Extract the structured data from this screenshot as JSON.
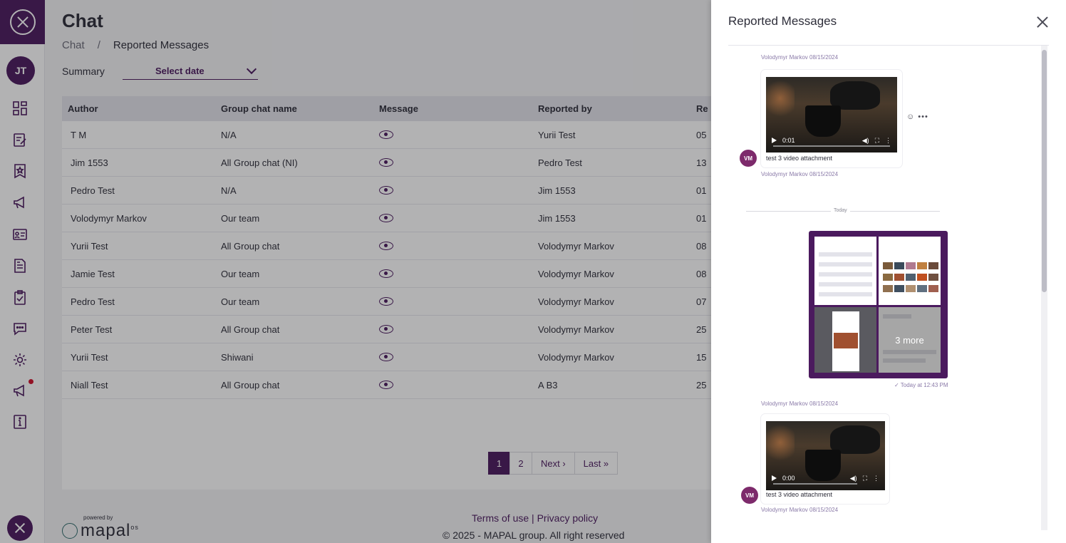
{
  "sidebar": {
    "avatar_initials": "JT",
    "icons": [
      "dashboard-icon",
      "edit-icon",
      "bookmark-star-icon",
      "megaphone-icon",
      "id-card-icon",
      "document-icon",
      "clipboard-icon",
      "chat-icon",
      "gear-icon",
      "announcement-icon",
      "info-icon"
    ]
  },
  "page": {
    "title": "Chat",
    "breadcrumb": [
      "Chat",
      "/",
      "Reported Messages"
    ],
    "summary_label": "Summary",
    "date_placeholder": "Select date"
  },
  "table": {
    "columns": [
      "Author",
      "Group chat name",
      "Message",
      "Reported by",
      "Re"
    ],
    "rows": [
      {
        "author": "T M",
        "group": "N/A",
        "reported_by": "Yurii Test",
        "r": "05"
      },
      {
        "author": "Jim 1553",
        "group": "All Group chat (NI)",
        "reported_by": "Pedro Test",
        "r": "13"
      },
      {
        "author": "Pedro Test",
        "group": "N/A",
        "reported_by": "Jim 1553",
        "r": "01"
      },
      {
        "author": "Volodymyr Markov",
        "group": "Our team",
        "reported_by": "Jim 1553",
        "r": "01"
      },
      {
        "author": "Yurii Test",
        "group": "All Group chat",
        "reported_by": "Volodymyr Markov",
        "r": "08"
      },
      {
        "author": "Jamie Test",
        "group": "Our team",
        "reported_by": "Volodymyr Markov",
        "r": "08"
      },
      {
        "author": "Pedro Test",
        "group": "Our team",
        "reported_by": "Volodymyr Markov",
        "r": "07"
      },
      {
        "author": "Peter Test",
        "group": "All Group chat",
        "reported_by": "Volodymyr Markov",
        "r": "25"
      },
      {
        "author": "Yurii Test",
        "group": "Shiwani",
        "reported_by": "Volodymyr Markov",
        "r": "15"
      },
      {
        "author": "Niall Test",
        "group": "All Group chat",
        "reported_by": "A B3",
        "r": "25"
      }
    ]
  },
  "pagination": {
    "pages": [
      "1",
      "2"
    ],
    "next": "Next ›",
    "last": "Last »"
  },
  "footer": {
    "powered_by": "powered by",
    "brand": "mapal",
    "brand_suffix": "os",
    "terms": "Terms of use",
    "separator": " | ",
    "privacy": "Privacy policy",
    "copyright": "© 2025 - MAPAL group. All right reserved"
  },
  "panel": {
    "title": "Reported Messages",
    "messages": [
      {
        "top_meta": "Volodymyr Markov  08/15/2024",
        "time": "0:01",
        "caption": "test 3 video attachment",
        "author_meta": "Volodymyr Markov  08/15/2024",
        "initials": "VM"
      },
      {
        "time": "0:00",
        "caption": "test 3 video attachment",
        "author_meta": "Volodymyr Markov  08/15/2024",
        "initials": "VM",
        "top_meta": "Volodymyr Markov  08/15/2024"
      }
    ],
    "day_label": "Today",
    "gallery_more": "3 more",
    "gallery_time": "✓ Today at 12:43 PM",
    "actions": "☺ •••"
  }
}
